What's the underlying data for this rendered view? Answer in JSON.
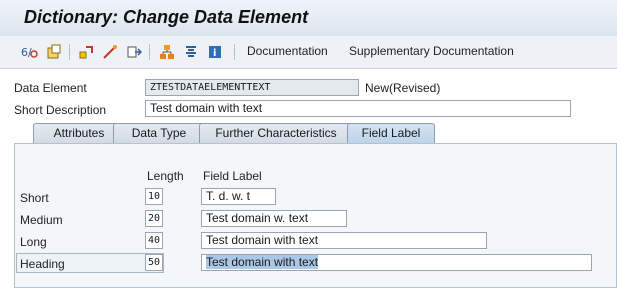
{
  "window": {
    "title": "Dictionary: Change Data Element"
  },
  "toolbar": {
    "icons": [
      "toggle-display-change-icon",
      "other-object-icon",
      "activate-icon",
      "check-icon",
      "where-used-icon",
      "hierarchy-icon",
      "align-icon",
      "info-icon"
    ],
    "documentation_label": "Documentation",
    "supplementary_label": "Supplementary Documentation"
  },
  "header": {
    "data_element_label": "Data Element",
    "data_element_value": "ZTESTDATAELEMENTTEXT",
    "status": "New(Revised)",
    "short_desc_label": "Short Description",
    "short_desc_value": "Test domain with text"
  },
  "tabs": [
    {
      "label": "Attributes",
      "active": false
    },
    {
      "label": "Data Type",
      "active": false
    },
    {
      "label": "Further Characteristics",
      "active": false
    },
    {
      "label": "Field Label",
      "active": true
    }
  ],
  "field_label": {
    "length_header": "Length",
    "label_header": "Field Label",
    "rows": [
      {
        "name": "Short",
        "length": "10",
        "label": "T. d. w. t"
      },
      {
        "name": "Medium",
        "length": "20",
        "label": "Test domain w. text"
      },
      {
        "name": "Long",
        "length": "40",
        "label": "Test domain with text"
      },
      {
        "name": "Heading",
        "length": "50",
        "label": "Test domain with text"
      }
    ]
  }
}
